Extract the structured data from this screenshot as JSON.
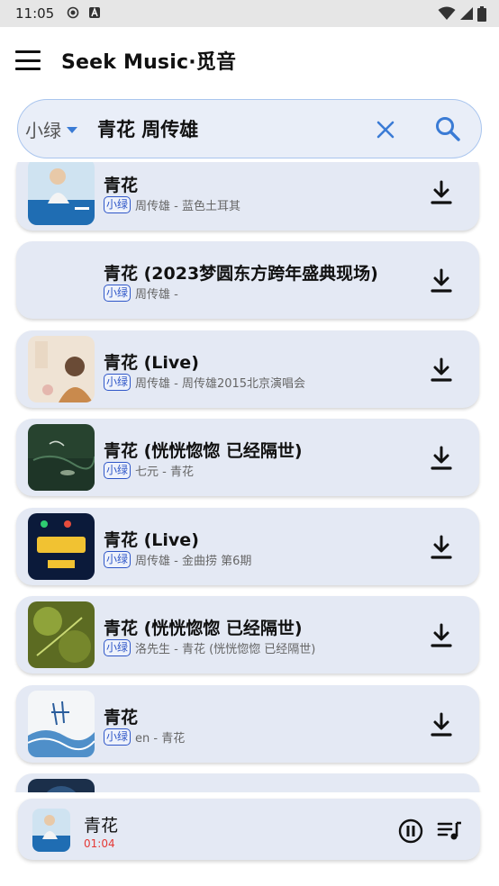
{
  "status_bar": {
    "time": "11:05"
  },
  "app_bar": {
    "title": "Seek Music·觅音"
  },
  "search": {
    "source": "小绿",
    "query": "青花 周传雄"
  },
  "results": [
    {
      "title": "青花",
      "badge": "小绿",
      "subtitle": "周传雄 - 蓝色土耳其",
      "cover": "blue-portrait"
    },
    {
      "title": "青花 (2023梦圆东方跨年盛典现场)",
      "badge": "小绿",
      "subtitle": "周传雄 -",
      "cover": "none"
    },
    {
      "title": "青花 (Live)",
      "badge": "小绿",
      "subtitle": "周传雄 - 周传雄2015北京演唱会",
      "cover": "concert-poster"
    },
    {
      "title": "青花 (恍恍惚惚 已经隔世)",
      "badge": "小绿",
      "subtitle": "七元 - 青花",
      "cover": "green-water"
    },
    {
      "title": "青花 (Live)",
      "badge": "小绿",
      "subtitle": "周传雄 - 金曲捞 第6期",
      "cover": "gold-logo"
    },
    {
      "title": "青花 (恍恍惚惚 已经隔世)",
      "badge": "小绿",
      "subtitle": "洛先生 - 青花 (恍恍惚惚 已经隔世)",
      "cover": "green-leaves"
    },
    {
      "title": "青花",
      "badge": "小绿",
      "subtitle": "en - 青花",
      "cover": "ink-water"
    }
  ],
  "player": {
    "title": "青花",
    "time": "01:04"
  },
  "colors": {
    "accent": "#3a7bd5",
    "card": "#e4e9f4",
    "badge": "#2f57c8",
    "time": "#e53935"
  }
}
